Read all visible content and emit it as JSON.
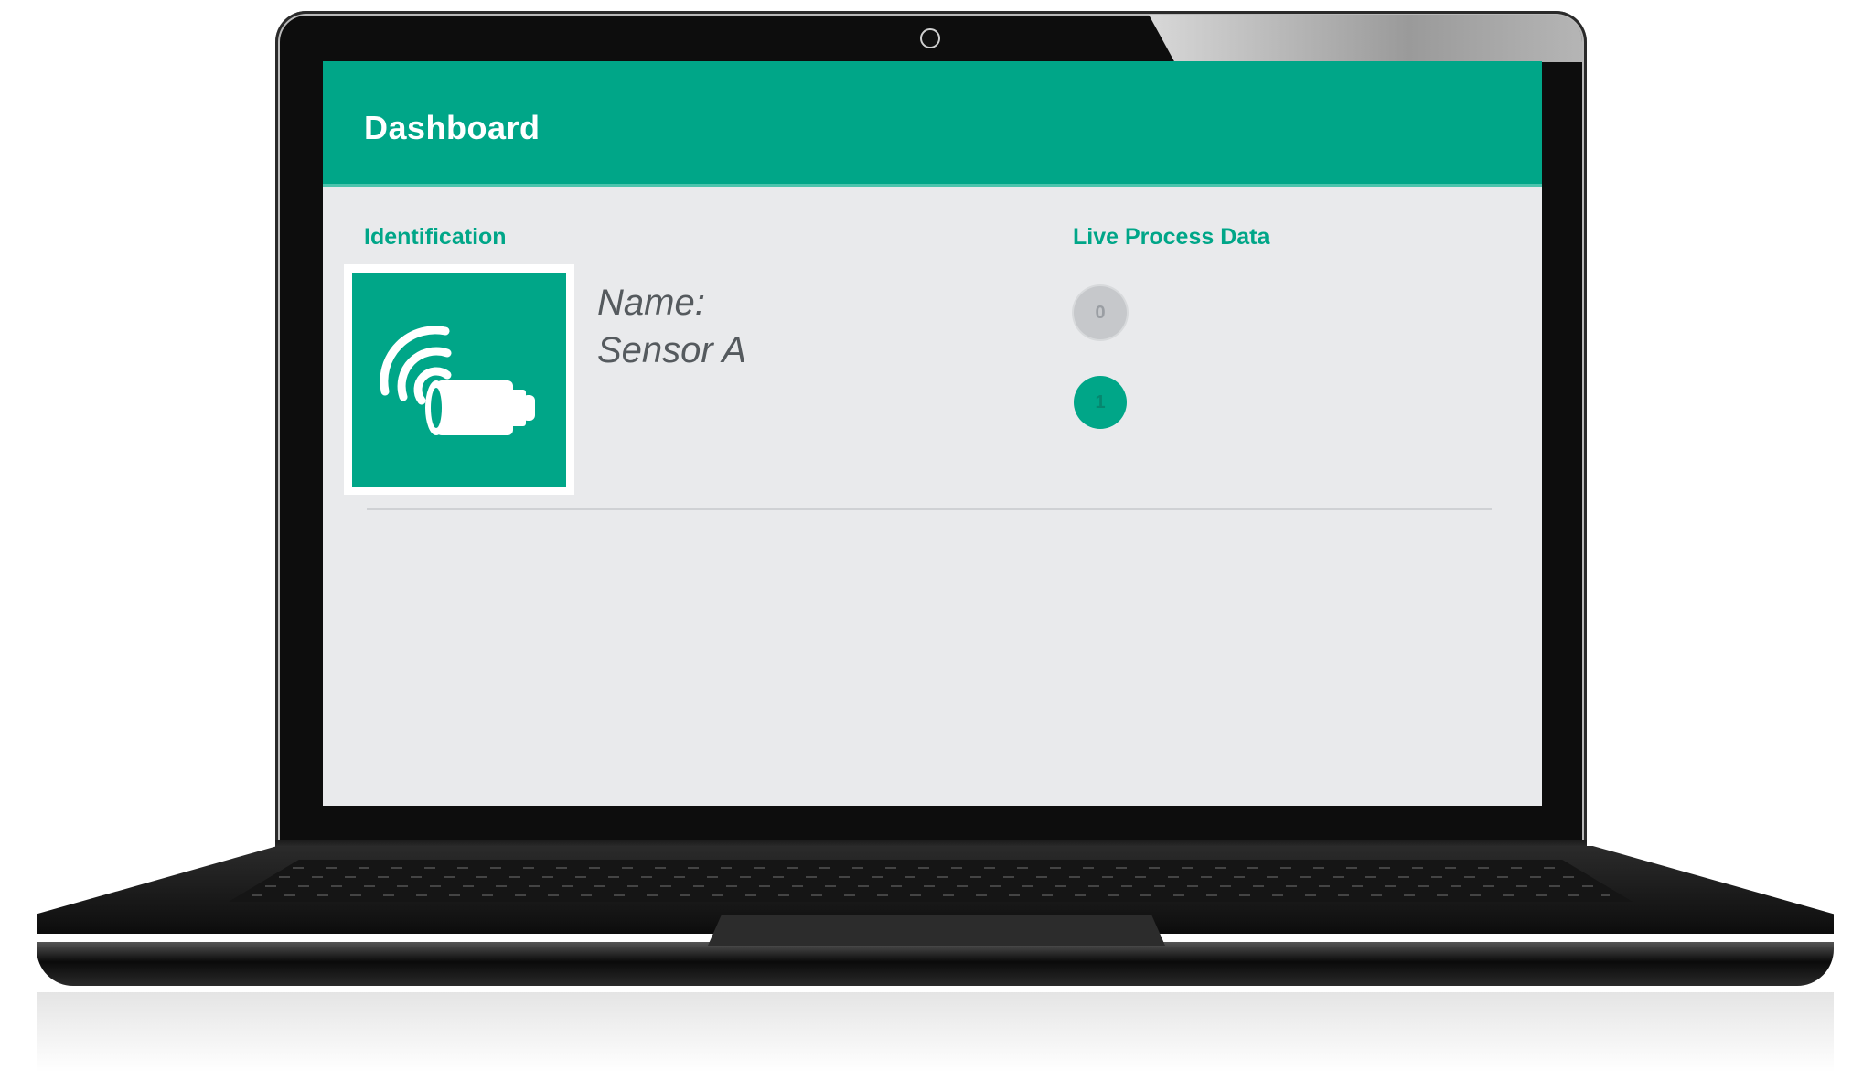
{
  "header": {
    "title": "Dashboard"
  },
  "identification": {
    "section_label": "Identification",
    "device_icon": "wireless-sensor-icon",
    "name_label": "Name:",
    "name_value": "Sensor A"
  },
  "live_process_data": {
    "section_label": "Live Process Data",
    "indicators": [
      {
        "label": "0",
        "state": "off"
      },
      {
        "label": "1",
        "state": "on"
      }
    ]
  },
  "colors": {
    "accent": "#00a688",
    "screen_background": "#e9eaec",
    "text_muted": "#555a5e",
    "indicator_off": "#c6c8cb"
  }
}
